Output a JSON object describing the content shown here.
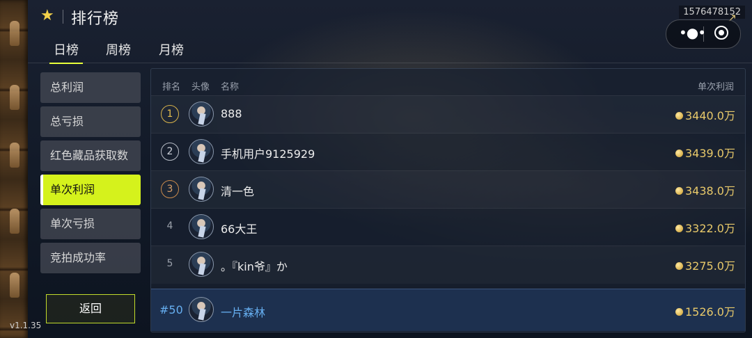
{
  "header": {
    "title": "排行榜",
    "user_id": "1576478152"
  },
  "tabs": [
    {
      "label": "日榜",
      "active": true
    },
    {
      "label": "周榜",
      "active": false
    },
    {
      "label": "月榜",
      "active": false
    }
  ],
  "sidebar": {
    "items": [
      {
        "label": "总利润",
        "active": false
      },
      {
        "label": "总亏损",
        "active": false
      },
      {
        "label": "红色藏品获取数",
        "active": false
      },
      {
        "label": "单次利润",
        "active": true
      },
      {
        "label": "单次亏损",
        "active": false
      },
      {
        "label": "竞拍成功率",
        "active": false
      }
    ],
    "back_label": "返回",
    "version": "v1.1.35"
  },
  "board": {
    "columns": {
      "rank": "排名",
      "avatar": "头像",
      "name": "名称",
      "value": "单次利润"
    },
    "rows": [
      {
        "rank": "1",
        "name": "888",
        "value": "3440.0万"
      },
      {
        "rank": "2",
        "name": "手机用户9125929",
        "value": "3439.0万"
      },
      {
        "rank": "3",
        "name": "清一色",
        "value": "3438.0万"
      },
      {
        "rank": "4",
        "name": "66大王",
        "value": "3322.0万"
      },
      {
        "rank": "5",
        "name": "。『kin爷』か",
        "value": "3275.0万"
      }
    ],
    "me": {
      "rank": "#50",
      "name": "一片森林",
      "value": "1526.0万"
    }
  },
  "colors": {
    "accent": "#d5f21c",
    "gold": "#e8c96a",
    "me": "#66aef0"
  }
}
